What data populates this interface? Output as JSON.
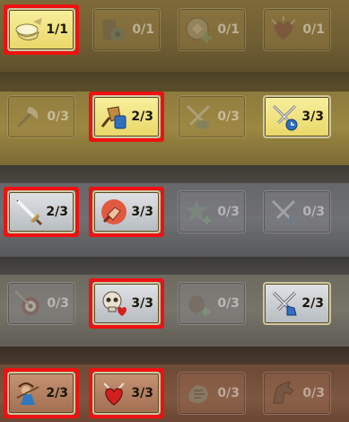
{
  "rows": [
    {
      "tier": "gold-top",
      "items": [
        {
          "icon": "helmet-axe-icon",
          "count": "1/1",
          "active": true,
          "highlighted": true
        },
        {
          "icon": "engineer-gear-icon",
          "count": "0/1",
          "active": false,
          "highlighted": false
        },
        {
          "icon": "shield-plus-icon",
          "count": "0/1",
          "active": false,
          "highlighted": false
        },
        {
          "icon": "heart-burst-icon",
          "count": "0/1",
          "active": false,
          "highlighted": false
        }
      ]
    },
    {
      "tier": "gold",
      "items": [
        {
          "icon": "axe-icon",
          "count": "0/3",
          "active": false,
          "highlighted": false
        },
        {
          "icon": "blue-shield-hammer-icon",
          "count": "2/3",
          "active": true,
          "highlighted": true
        },
        {
          "icon": "crossed-swords-pouch-icon",
          "count": "0/3",
          "active": false,
          "highlighted": false
        },
        {
          "icon": "crossed-swords-clock-icon",
          "count": "3/3",
          "active": true,
          "highlighted": false
        }
      ]
    },
    {
      "tier": "silver",
      "items": [
        {
          "icon": "sword-icon",
          "count": "2/3",
          "active": true,
          "highlighted": true
        },
        {
          "icon": "fist-icon",
          "count": "3/3",
          "active": true,
          "highlighted": true
        },
        {
          "icon": "star-plus-icon",
          "count": "0/3",
          "active": false,
          "highlighted": false
        },
        {
          "icon": "crossed-swords-plus-icon",
          "count": "0/3",
          "active": false,
          "highlighted": false
        }
      ]
    },
    {
      "tier": "silver",
      "items": [
        {
          "icon": "target-arrow-icon",
          "count": "0/3",
          "active": false,
          "highlighted": false
        },
        {
          "icon": "skull-heart-icon",
          "count": "3/3",
          "active": true,
          "highlighted": true
        },
        {
          "icon": "sack-plus-icon",
          "count": "0/3",
          "active": false,
          "highlighted": false
        },
        {
          "icon": "crossed-swords-boot-icon",
          "count": "2/3",
          "active": true,
          "highlighted": false
        }
      ]
    },
    {
      "tier": "bronze",
      "items": [
        {
          "icon": "soldier-bow-icon",
          "count": "2/3",
          "active": true,
          "highlighted": true
        },
        {
          "icon": "heart-swords-icon",
          "count": "3/3",
          "active": true,
          "highlighted": true
        },
        {
          "icon": "green-hand-icon",
          "count": "0/3",
          "active": false,
          "highlighted": false
        },
        {
          "icon": "horse-icon",
          "count": "0/3",
          "active": false,
          "highlighted": false
        }
      ]
    }
  ],
  "colors": {
    "highlight_red": "#ee1111",
    "gold_active": "#f2e480",
    "silver_active": "#cfd3d7",
    "bronze_active": "#b5805f"
  }
}
